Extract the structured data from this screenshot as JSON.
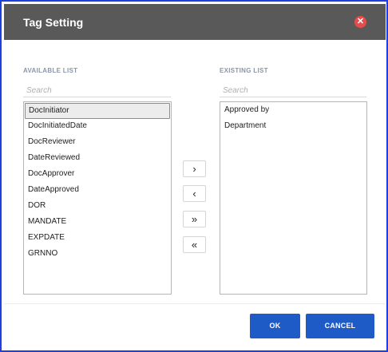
{
  "dialog": {
    "title": "Tag Setting",
    "close_icon": "close-icon",
    "close_glyph": "✕",
    "accent_color": "#1f5bc7",
    "header_color": "#595959",
    "close_color": "#e74c4c"
  },
  "available": {
    "label": "AVAILABLE LIST",
    "search_placeholder": "Search",
    "selected_value": "DocInitiator",
    "items": [
      "DocInitiator",
      "DocInitiatedDate",
      "DocReviewer",
      "DateReviewed",
      "DocApprover",
      "DateApproved",
      "DOR",
      "MANDATE",
      "EXPDATE",
      "GRNNO"
    ]
  },
  "existing": {
    "label": "EXISTING LIST",
    "search_placeholder": "Search",
    "items": [
      "Approved by",
      "Department"
    ]
  },
  "controls": {
    "move_right": "›",
    "move_left": "‹",
    "move_all_right": "»",
    "move_all_left": "«"
  },
  "footer": {
    "ok_label": "OK",
    "cancel_label": "CANCEL"
  }
}
